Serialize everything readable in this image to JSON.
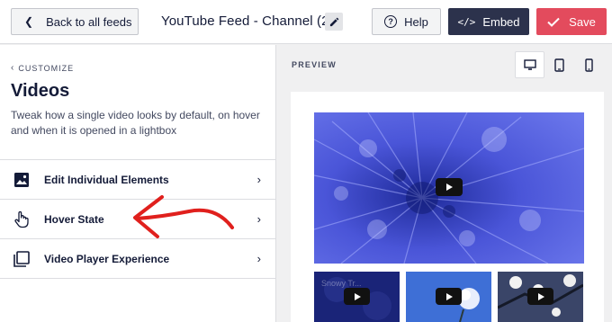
{
  "header": {
    "back_label": "Back to all feeds",
    "title": "YouTube Feed - Channel (2)",
    "help_label": "Help",
    "embed_label": "Embed",
    "save_label": "Save"
  },
  "sidebar": {
    "breadcrumb": "CUSTOMIZE",
    "heading": "Videos",
    "description": "Tweak how a single video looks by default, on hover and when it is opened in a lightbox",
    "items": [
      {
        "label": "Edit Individual Elements",
        "icon": "image-icon"
      },
      {
        "label": "Hover State",
        "icon": "hand-pointer-icon"
      },
      {
        "label": "Video Player Experience",
        "icon": "copy-icon"
      }
    ]
  },
  "preview": {
    "label": "PREVIEW",
    "devices": [
      "desktop-icon",
      "tablet-icon",
      "mobile-icon"
    ],
    "active_device": "desktop",
    "thumb_1_overlay": "Snowy Tr..."
  },
  "colors": {
    "save": "#e34b5d",
    "embed": "#2c324c",
    "annotation_arrow": "#e0201d"
  }
}
